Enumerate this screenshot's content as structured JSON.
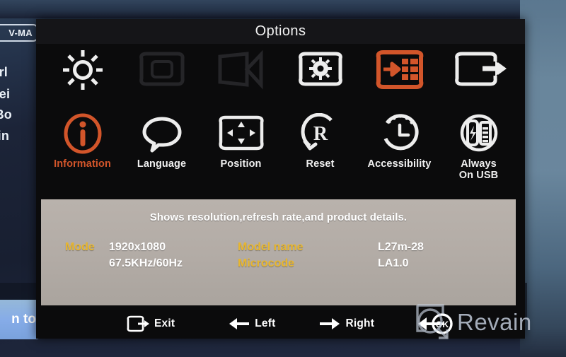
{
  "osd": {
    "title": "Options",
    "menu_top": [
      {
        "label": "",
        "icon": "brightness-sun-icon",
        "selected": false,
        "dim": false
      },
      {
        "label": "",
        "icon": "screen-contrast-icon",
        "selected": false,
        "dim": true
      },
      {
        "label": "",
        "icon": "color-mode-icon",
        "selected": false,
        "dim": true
      },
      {
        "label": "",
        "icon": "gear-settings-icon",
        "selected": false,
        "dim": false
      },
      {
        "label": "",
        "icon": "options-grid-arrow-icon",
        "selected": true,
        "dim": false
      },
      {
        "label": "",
        "icon": "exit-arrow-icon",
        "selected": false,
        "dim": false
      }
    ],
    "menu_bottom": [
      {
        "label": "Information",
        "icon": "information-circle-icon",
        "selected": true
      },
      {
        "label": "Language",
        "icon": "speech-bubble-icon",
        "selected": false
      },
      {
        "label": "Position",
        "icon": "position-arrows-icon",
        "selected": false
      },
      {
        "label": "Reset",
        "icon": "reset-r-icon",
        "selected": false
      },
      {
        "label": "Accessibility",
        "icon": "clock-accessibility-icon",
        "selected": false
      },
      {
        "label": "Always\nOn USB",
        "icon": "usb-charge-icon",
        "selected": false
      }
    ],
    "description": "Shows resolution,refresh rate,and product details.",
    "info": {
      "mode_key": "Mode",
      "mode_resolution": "1920x1080",
      "mode_frequency": "67.5KHz/60Hz",
      "model_key": "Model name",
      "microcode_key": "Microcode",
      "model_value": "L27m-28",
      "microcode_value": "LA1.0"
    },
    "hints": [
      {
        "label": "Exit",
        "icon": "exit-arrow-icon"
      },
      {
        "label": "Left",
        "icon": "arrow-left-icon"
      },
      {
        "label": "Right",
        "icon": "arrow-right-icon"
      },
      {
        "label": "",
        "icon": "ok-button-icon"
      }
    ],
    "colors": {
      "accent_orange": "#d2552a",
      "info_key_yellow": "#e8b730",
      "panel_gray": "#b3aca6",
      "osd_black": "#0b0b0c"
    }
  },
  "background": {
    "tag": "V-MA",
    "line1": "uperl",
    "line2": "e thei",
    "line3": "ne Bo",
    "line4": "ackin",
    "button": "n to"
  },
  "watermark": {
    "text": "Revain",
    "ok_label": "OK"
  }
}
